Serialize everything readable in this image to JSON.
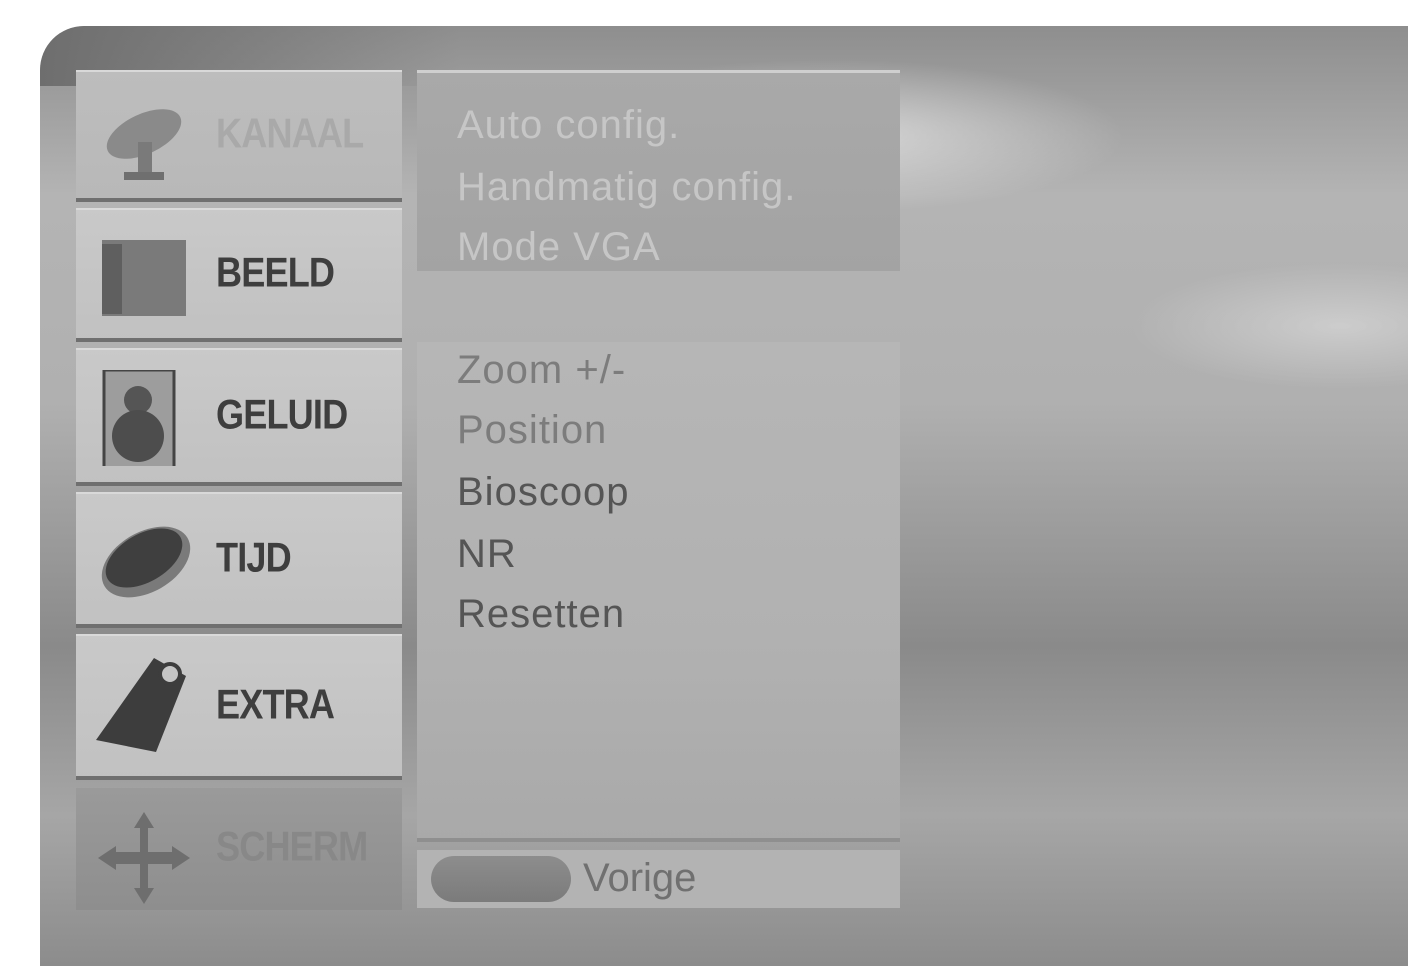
{
  "sidebar": {
    "items": [
      {
        "label": "KANAAL",
        "icon": "satellite-dish-icon"
      },
      {
        "label": "BEELD",
        "icon": "picture-frame-icon"
      },
      {
        "label": "GELUID",
        "icon": "speaker-icon"
      },
      {
        "label": "TIJD",
        "icon": "clock-icon"
      },
      {
        "label": "EXTRA",
        "icon": "tag-icon"
      },
      {
        "label": "SCHERM",
        "icon": "move-arrows-icon"
      }
    ]
  },
  "top_options": [
    "Auto config.",
    "Handmatig config.",
    "Mode VGA"
  ],
  "main_options": [
    "Zoom +/-",
    "Position",
    "Bioscoop",
    "NR",
    "Resetten"
  ],
  "footer": {
    "back_label": "Vorige"
  },
  "colors": {
    "panel": "#b3b3b3",
    "text": "#555555"
  }
}
